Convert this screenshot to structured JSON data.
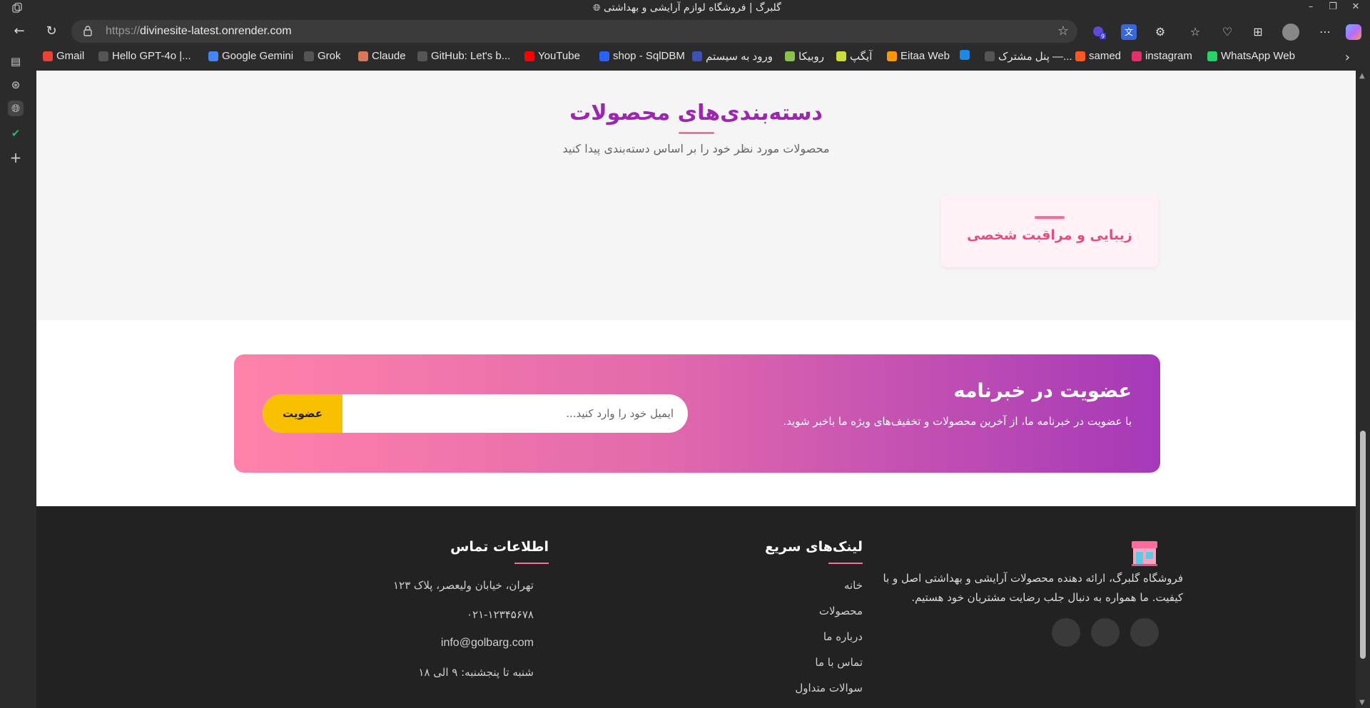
{
  "browser": {
    "window_title": "گلبرگ | فروشگاه لوازم آرایشی و بهداشتی",
    "url_scheme": "https://",
    "url_host": "divinesite-latest.onrender.com",
    "extension_badge": "9",
    "bookmarks": [
      {
        "label": "Gmail",
        "color": "#ea4335"
      },
      {
        "label": "Hello GPT-4o |...",
        "color": "#555555"
      },
      {
        "label": "Google Gemini",
        "color": "#4285f4"
      },
      {
        "label": "Grok",
        "color": "#555555"
      },
      {
        "label": "Claude",
        "color": "#d97757"
      },
      {
        "label": "GitHub: Let's b...",
        "color": "#555555"
      },
      {
        "label": "YouTube",
        "color": "#ff0000"
      },
      {
        "label": "shop - SqlDBM",
        "color": "#2962ff"
      },
      {
        "label": "ورود به سیستم",
        "color": "#3f51b5"
      },
      {
        "label": "روبیکا",
        "color": "#8bc34a"
      },
      {
        "label": "آیگپ",
        "color": "#cddc39"
      },
      {
        "label": "Eitaa Web",
        "color": "#ff9800"
      },
      {
        "label": "",
        "color": "#1e88e5"
      },
      {
        "label": "پنل مشترک —...",
        "color": "#555555"
      },
      {
        "label": "samed",
        "color": "#ff5722"
      },
      {
        "label": "instagram",
        "color": "#e1306c"
      },
      {
        "label": "WhatsApp Web",
        "color": "#25d366"
      }
    ]
  },
  "categories": {
    "title": "دسته‌بندی‌های محصولات",
    "subtitle": "محصولات مورد نظر خود را بر اساس دسته‌بندی پیدا کنید",
    "items": [
      {
        "label": "زیبایی و مراقبت شخصی"
      }
    ]
  },
  "newsletter": {
    "title": "عضویت در خبرنامه",
    "description": "با عضویت در خبرنامه ما، از آخرین محصولات و تخفیف‌های ویژه ما باخبر شوید.",
    "input_placeholder": "ایمیل خود را وارد کنید...",
    "button_label": "عضویت"
  },
  "footer": {
    "about": "فروشگاه گلبرگ، ارائه دهنده محصولات آرایشی و بهداشتی اصل و با کیفیت. ما همواره به دنبال جلب رضایت مشتریان خود هستیم.",
    "quick_links_title": "لینک‌های سریع",
    "quick_links": [
      "خانه",
      "محصولات",
      "درباره ما",
      "تماس با ما",
      "سوالات متداول"
    ],
    "contact_title": "اطلاعات تماس",
    "contact": {
      "address": "تهران، خیابان ولیعصر، پلاک ۱۲۳",
      "phone": "۰۲۱-۱۲۳۴۵۶۷۸",
      "email": "info@golbarg.com",
      "hours": "شنبه تا پنجشنبه: ۹ الی ۱۸"
    }
  },
  "colors": {
    "accent_purple": "#9b27af",
    "accent_pink": "#ff6b9d",
    "button_yellow": "#f8c000",
    "footer_bg": "#222222"
  }
}
